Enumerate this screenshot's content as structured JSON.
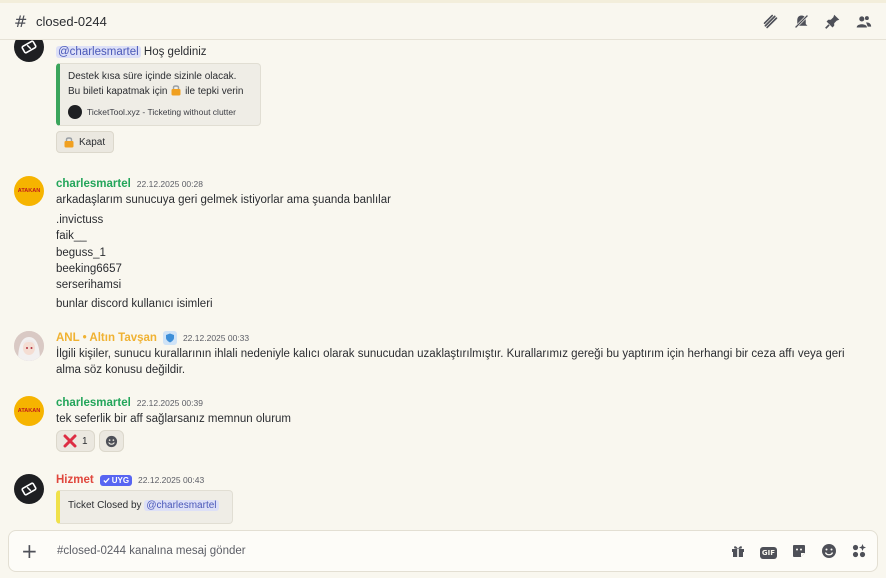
{
  "channel": {
    "name": "closed-0244"
  },
  "messages": {
    "m0": {
      "mention": "@charlesmartel",
      "text": " Hoş geldiniz",
      "embed": {
        "line1": "Destek kısa süre içinde sizinle olacak.",
        "line2a": "Bu bileti kapatmak için",
        "line2b": "ile tepki verin",
        "footer": "TicketTool.xyz - Ticketing without clutter"
      },
      "button": "Kapat"
    },
    "m1": {
      "author": "charlesmartel",
      "time": "22.12.2025 00:28",
      "lines": [
        "arkadaşlarım sunucuya geri gelmek istiyorlar ama şuanda banlılar",
        ".invictuss",
        "faik__",
        "beguss_1",
        "beeking6657",
        "serserihamsi",
        "bunlar discord kullanıcı isimleri"
      ],
      "avatar_text": "ATAKAN"
    },
    "m2": {
      "author": "ANL • Altın Tavşan",
      "time": "22.12.2025 00:33",
      "text": "İlgili kişiler, sunucu kurallarının ihlali nedeniyle kalıcı olarak sunucudan uzaklaştırılmıştır. Kurallarımız gereği bu yaptırım için herhangi bir ceza affı veya geri alma söz konusu değildir."
    },
    "m3": {
      "author": "charlesmartel",
      "time": "22.12.2025 00:39",
      "text": "tek seferlik bir aff sağlarsanız memnun olurum",
      "reaction_count": "1",
      "avatar_text": "ATAKAN"
    },
    "m4": {
      "author": "Hizmet",
      "badge": "UYG",
      "time": "22.12.2025 00:43",
      "embed_text": "Ticket Closed by ",
      "embed_mention": "@charlesmartel"
    }
  },
  "composer": {
    "placeholder": "#closed-0244 kanalına mesaj gönder"
  },
  "colors": {
    "green_user": "#23a55a",
    "gold_user": "#f0b232",
    "red_user": "#e0463c",
    "embed_green": "#3ba55c",
    "embed_yellow": "#f0e14a"
  }
}
